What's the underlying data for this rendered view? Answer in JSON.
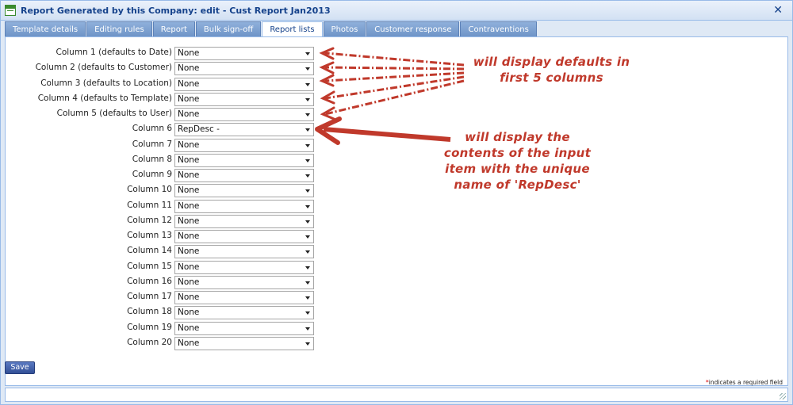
{
  "window": {
    "title": "Report Generated by this Company: edit - Cust Report Jan2013",
    "close_glyph": "✕"
  },
  "tabs": [
    {
      "label": "Template details",
      "active": false
    },
    {
      "label": "Editing rules",
      "active": false
    },
    {
      "label": "Report",
      "active": false
    },
    {
      "label": "Bulk sign-off",
      "active": false
    },
    {
      "label": "Report lists",
      "active": true
    },
    {
      "label": "Photos",
      "active": false
    },
    {
      "label": "Customer response",
      "active": false
    },
    {
      "label": "Contraventions",
      "active": false
    }
  ],
  "columns": [
    {
      "label": "Column 1 (defaults to Date)",
      "value": "None"
    },
    {
      "label": "Column 2 (defaults to Customer)",
      "value": "None"
    },
    {
      "label": "Column 3 (defaults to Location)",
      "value": "None"
    },
    {
      "label": "Column 4 (defaults to Template)",
      "value": "None"
    },
    {
      "label": "Column 5 (defaults to User)",
      "value": "None"
    },
    {
      "label": "Column 6",
      "value": "RepDesc -"
    },
    {
      "label": "Column 7",
      "value": "None"
    },
    {
      "label": "Column 8",
      "value": "None"
    },
    {
      "label": "Column 9",
      "value": "None"
    },
    {
      "label": "Column 10",
      "value": "None"
    },
    {
      "label": "Column 11",
      "value": "None"
    },
    {
      "label": "Column 12",
      "value": "None"
    },
    {
      "label": "Column 13",
      "value": "None"
    },
    {
      "label": "Column 14",
      "value": "None"
    },
    {
      "label": "Column 15",
      "value": "None"
    },
    {
      "label": "Column 16",
      "value": "None"
    },
    {
      "label": "Column 17",
      "value": "None"
    },
    {
      "label": "Column 18",
      "value": "None"
    },
    {
      "label": "Column 19",
      "value": "None"
    },
    {
      "label": "Column 20",
      "value": "None"
    }
  ],
  "save_label": "Save",
  "required_note": {
    "star": "*",
    "text": "indicates a required field"
  },
  "annotations": {
    "defaults_note_line1": "will display defaults in",
    "defaults_note_line2": "first 5 columns",
    "repdesc_note_line1": "will display the",
    "repdesc_note_line2": "contents of the input",
    "repdesc_note_line3": "item with the unique",
    "repdesc_note_line4": "name of 'RepDesc'"
  },
  "colors": {
    "annotation": "#c0392b",
    "accent": "#15428b",
    "button": "#3a58a4"
  }
}
